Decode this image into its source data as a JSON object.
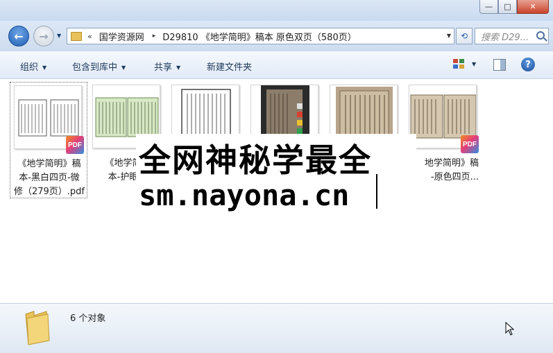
{
  "window": {
    "minimize_label": "—",
    "maximize_label": "□",
    "close_label": "✕"
  },
  "nav": {
    "back_label": "←",
    "forward_label": "→",
    "address": {
      "overflow": "«",
      "parts": [
        "国学资源网",
        "D29810 《地学简明》稿本 原色双页（580页）"
      ],
      "separator": "▸"
    },
    "refresh_label": "⟲",
    "search_placeholder": "搜索 D29..."
  },
  "toolbar": {
    "organize": "组织",
    "include_library": "包含到库中",
    "share": "共享",
    "new_folder": "新建文件夹"
  },
  "files": [
    {
      "name": "《地学简明》稿本-黑白四页-微修（279页）.pdf",
      "selected": true,
      "thumb": "bw-double"
    },
    {
      "name": "《地学简明》稿本-护眼色...",
      "selected": false,
      "thumb": "green-double"
    },
    {
      "name": "",
      "selected": false,
      "thumb": "bw-single"
    },
    {
      "name": "",
      "selected": false,
      "thumb": "dark"
    },
    {
      "name": "",
      "selected": false,
      "thumb": "sepia"
    },
    {
      "name": "《地学简明》稿本-原色四页...",
      "selected": false,
      "thumb": "color-double"
    }
  ],
  "file_labels": {
    "f0_l1": "《地学简明》稿",
    "f0_l2": "本-黑白四页-微",
    "f0_l3": "修（279页）.pdf",
    "f1_l1": "《地学简明",
    "f1_l2": "本-护眼色",
    "f5_l1": "地学简明》稿",
    "f5_l2": "-原色四页..."
  },
  "badge_text": "PDF",
  "overlay": {
    "line1": "全网神秘学最全",
    "line2": "sm.nayona.cn"
  },
  "status": {
    "count": "6 个对象"
  },
  "colors": {
    "chrome": "#cddcef",
    "toolbar_text": "#1e395b",
    "pdf_badge": "#e43e7a"
  }
}
